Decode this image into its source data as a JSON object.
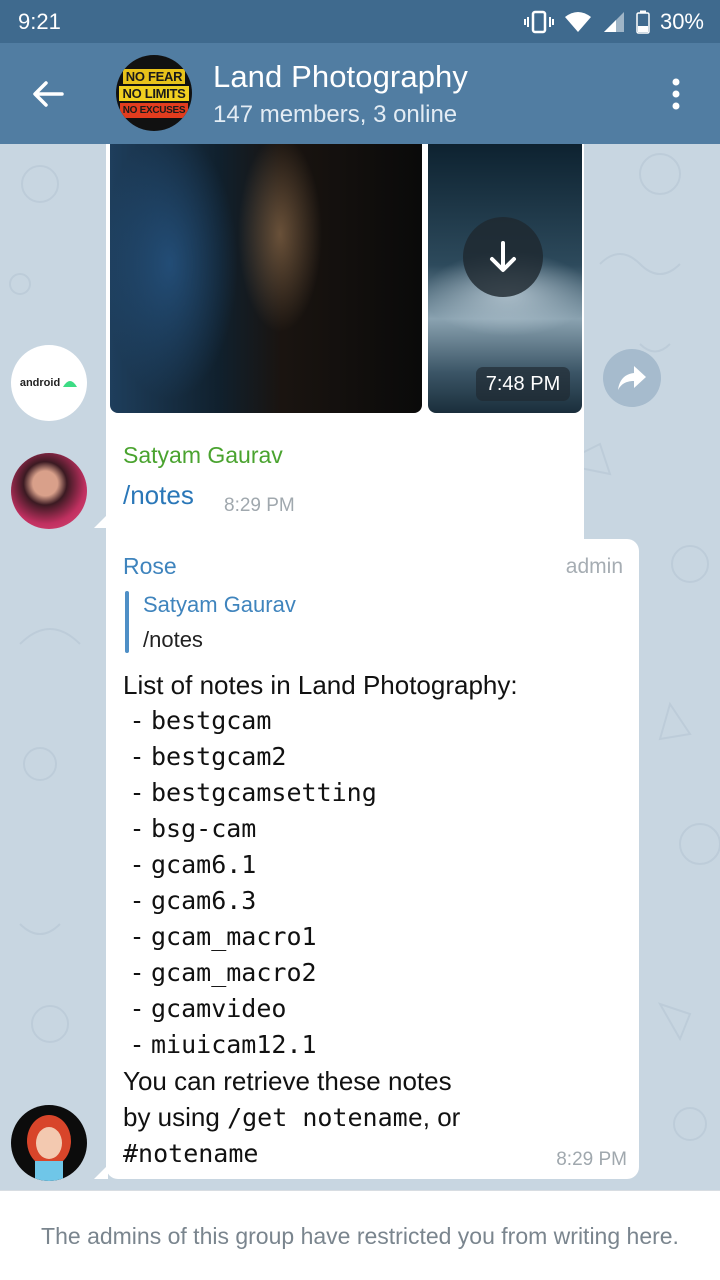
{
  "status_bar": {
    "time": "9:21",
    "battery": "30%"
  },
  "header": {
    "title": "Land Photography",
    "subtitle": "147 members, 3 online",
    "avatar_lines": [
      "NO FEAR",
      "NO LIMITS",
      "NO EXCUSES"
    ]
  },
  "media": {
    "time": "7:48 PM"
  },
  "avatars": {
    "android_label": "android"
  },
  "messages": [
    {
      "sender": "Satyam Gaurav",
      "text": "/notes",
      "time": "8:29 PM"
    },
    {
      "sender": "Rose",
      "badge": "admin",
      "reply_to": {
        "sender": "Satyam Gaurav",
        "text": "/notes"
      },
      "intro": "List of notes in Land Photography:",
      "notes": [
        "bestgcam",
        "bestgcam2",
        "bestgcamsetting",
        "bsg-cam",
        "gcam6.1",
        "gcam6.3",
        "gcam_macro1",
        "gcam_macro2",
        "gcamvideo",
        "miuicam12.1"
      ],
      "footer_1": "You can retrieve these notes",
      "footer_2a": "by using ",
      "footer_2_code": "/get notename",
      "footer_2b": ", or",
      "footer_3_code": "#notename",
      "time": "8:29 PM"
    }
  ],
  "restriction_text": "The admins of this group have restricted you from writing here."
}
